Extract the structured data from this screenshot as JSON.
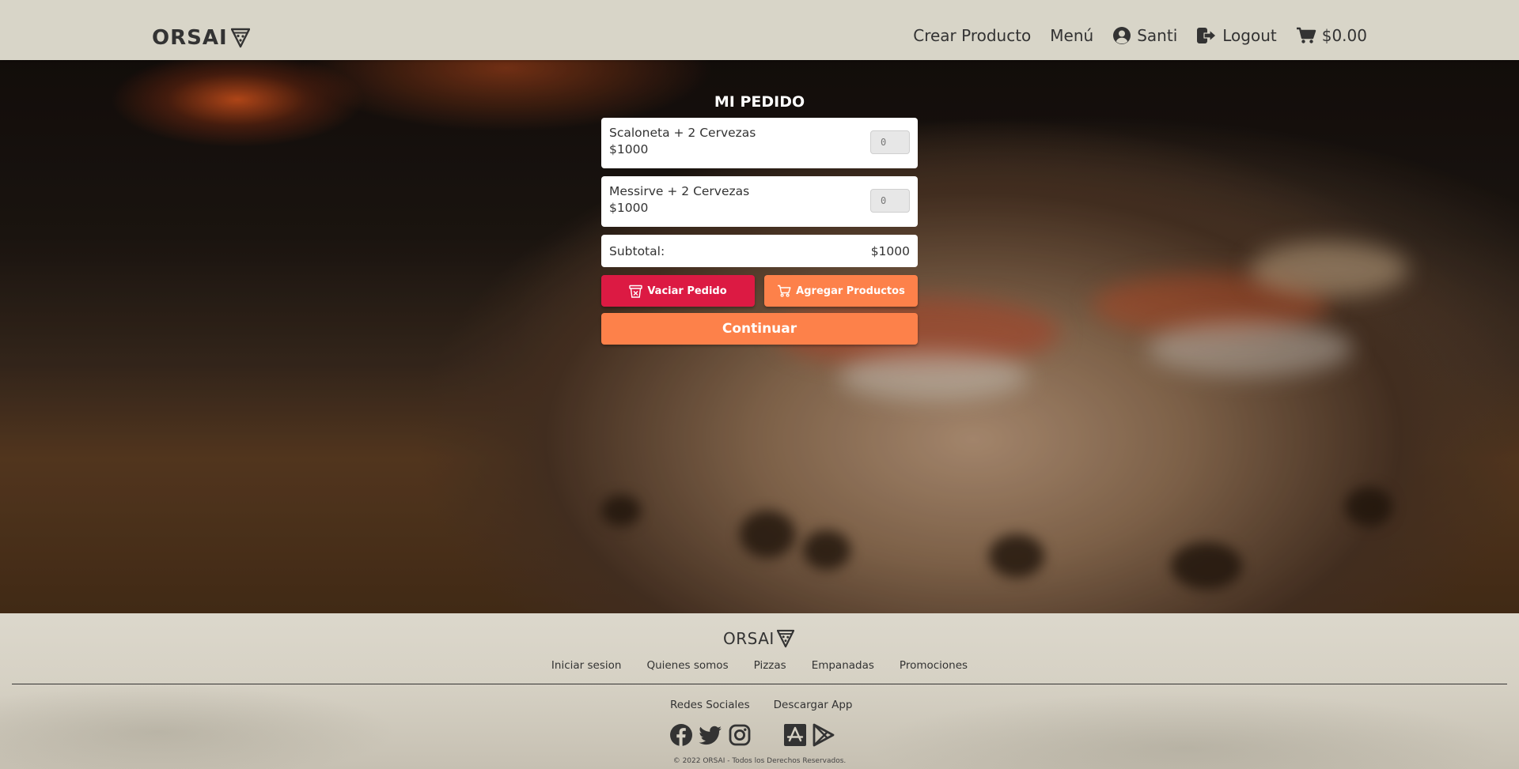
{
  "header": {
    "brand": "ORSAI",
    "nav": {
      "create_product": "Crear Producto",
      "menu": "Menú",
      "user": "Santi",
      "logout": "Logout",
      "cart_total": "$0.00"
    }
  },
  "order": {
    "title": "MI PEDIDO",
    "items": [
      {
        "name": "Scaloneta + 2 Cervezas",
        "price": "$1000",
        "quantity": "0"
      },
      {
        "name": "Messirve + 2 Cervezas",
        "price": "$1000",
        "quantity": "0"
      }
    ],
    "subtotal_label": "Subtotal:",
    "subtotal_value": "$1000",
    "clear_button": "Vaciar Pedido",
    "add_button": "Agregar Productos",
    "continue_button": "Continuar"
  },
  "footer": {
    "brand": "ORSAI",
    "links": [
      "Iniciar sesion",
      "Quienes somos",
      "Pizzas",
      "Empanadas",
      "Promociones"
    ],
    "social_heading": "Redes Sociales",
    "app_heading": "Descargar App",
    "copyright": "© 2022 ORSAI - Todos los Derechos Reservados."
  },
  "colors": {
    "accent_orange": "#fd814a",
    "danger_red": "#dc1a43",
    "header_bg": "#d8d5c8"
  },
  "icons": {
    "brand": "pizza-slice-icon",
    "user": "user-circle-icon",
    "logout": "logout-icon",
    "cart": "cart-icon",
    "clear": "trash-icon",
    "add": "cart-icon",
    "social": [
      "facebook-icon",
      "twitter-icon",
      "instagram-icon"
    ],
    "apps": [
      "app-store-icon",
      "google-play-icon"
    ]
  }
}
